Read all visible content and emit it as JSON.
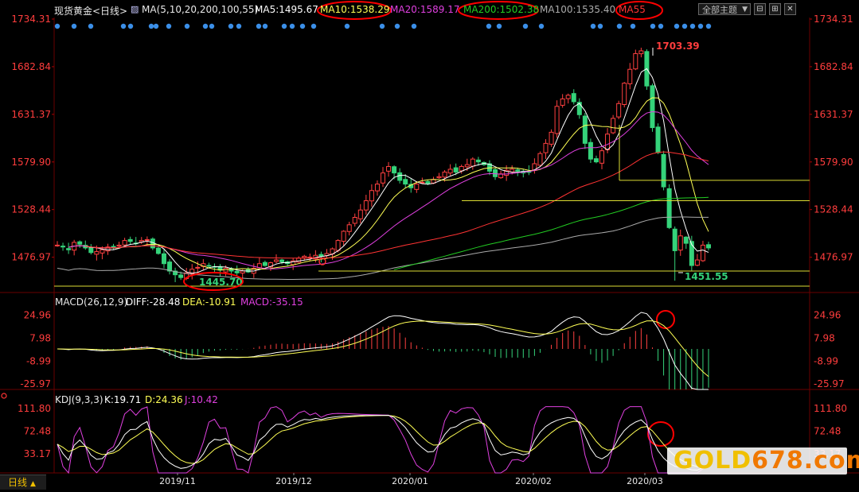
{
  "header": {
    "title": "现货黄金<日线>",
    "ma_label": "MA(5,10,20,200,100,55)",
    "ma5": "MA5:1495.67",
    "ma10": "MA10:1538.29",
    "ma20": "MA20:1589.17",
    "ma200": "MA200:1502.38",
    "ma100": "MA100:1535.40",
    "ma55": "MA55",
    "theme_button": "全部主题",
    "window_buttons": [
      "⊟",
      "⊞",
      "✕"
    ]
  },
  "price_axis": [
    "1734.31",
    "1682.84",
    "1631.37",
    "1579.90",
    "1528.44",
    "1476.97"
  ],
  "macd": {
    "label": "MACD(26,12,9)",
    "diff": "DIFF:-28.48",
    "dea": "DEA:-10.91",
    "macd": "MACD:-35.15",
    "axis": [
      "24.96",
      "7.98",
      "-8.99",
      "-25.97"
    ]
  },
  "kdj": {
    "label": "KDJ(9,3,3)",
    "k": "K:19.71",
    "d": "D:24.36",
    "j": "J:10.42",
    "axis": [
      "111.80",
      "72.48",
      "33.17"
    ]
  },
  "annotations": {
    "high": "1703.39",
    "low1": "1445.70",
    "low2": "1451.55"
  },
  "x_labels": [
    "2019/11",
    "2019/12",
    "2020/01",
    "2020/02",
    "2020/03"
  ],
  "timeframe": "日线",
  "watermark": {
    "a": "GOLD",
    "b": "678.com"
  },
  "colors": {
    "up": "#ff4040",
    "down": "#35d37a",
    "bg": "#000000",
    "axis_text": "#ff3d3d",
    "ma5": "#ffffff",
    "ma10": "#ffff55",
    "ma20": "#e040e0",
    "ma200": "#22cc22",
    "ma100": "#aaaaaa",
    "ma55": "#ff3333",
    "highlight": "#ff0000"
  },
  "chart_data": {
    "type": "candlestick",
    "series_name": "现货黄金",
    "interval": "daily",
    "x_range": [
      "2019/10",
      "2020/03"
    ],
    "y_range_price": [
      1445.7,
      1734.31
    ],
    "close_series": [
      1490,
      1488,
      1485,
      1493,
      1491,
      1487,
      1482,
      1483,
      1485,
      1488,
      1487,
      1490,
      1495,
      1494,
      1492,
      1495,
      1496,
      1487,
      1481,
      1470,
      1462,
      1458,
      1455,
      1460,
      1464,
      1466,
      1470,
      1468,
      1466,
      1463,
      1465,
      1462,
      1460,
      1462,
      1461,
      1465,
      1470,
      1468,
      1471,
      1474,
      1472,
      1470,
      1473,
      1476,
      1478,
      1477,
      1479,
      1478,
      1481,
      1486,
      1495,
      1505,
      1512,
      1520,
      1528,
      1538,
      1549,
      1556,
      1568,
      1575,
      1568,
      1560,
      1556,
      1552,
      1556,
      1558,
      1557,
      1561,
      1564,
      1569,
      1572,
      1569,
      1575,
      1577,
      1583,
      1580,
      1577,
      1570,
      1564,
      1567,
      1571,
      1572,
      1570,
      1568,
      1569,
      1578,
      1589,
      1600,
      1612,
      1640,
      1648,
      1652,
      1645,
      1631,
      1600,
      1583,
      1580,
      1592,
      1610,
      1627,
      1643,
      1665,
      1680,
      1697,
      1700,
      1662,
      1617,
      1590,
      1553,
      1509,
      1484,
      1500,
      1492,
      1468,
      1474,
      1490,
      1487
    ],
    "annotations": [
      {
        "label": "1703.39",
        "type": "high"
      },
      {
        "label": "1445.70",
        "type": "low"
      },
      {
        "label": "1451.55",
        "type": "low"
      }
    ],
    "indicators": {
      "MA5": 1495.67,
      "MA10": 1538.29,
      "MA20": 1589.17,
      "MA200": 1502.38,
      "MA100": 1535.4,
      "MACD": {
        "DIFF": -28.48,
        "DEA": -10.91,
        "MACD": -35.15
      },
      "KDJ": {
        "K": 19.71,
        "D": 24.36,
        "J": 10.42
      }
    },
    "ylim_macd": [
      -30,
      30
    ],
    "ylim_kdj": [
      0,
      120
    ]
  }
}
